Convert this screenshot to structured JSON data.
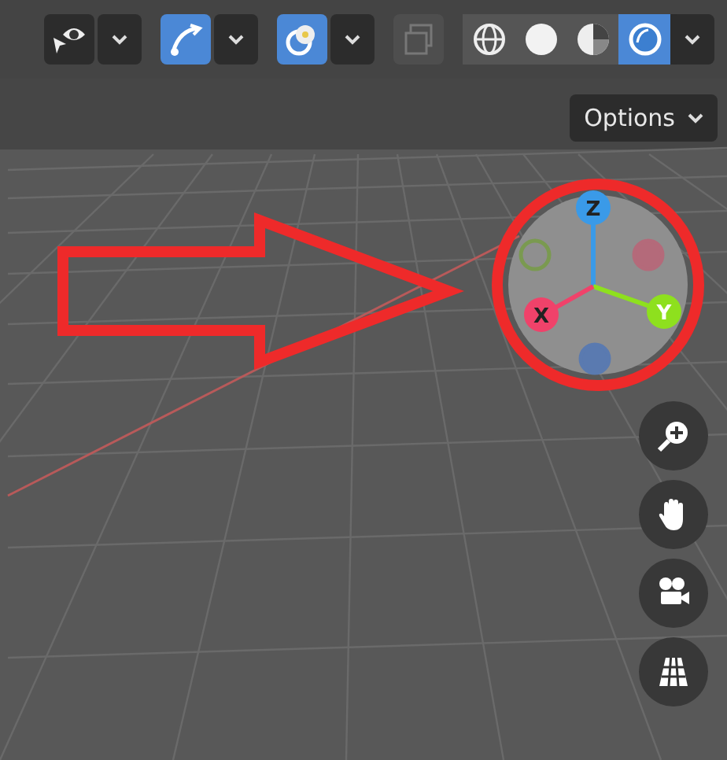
{
  "header": {
    "tools": [
      {
        "kind": "visibility",
        "selected": false,
        "disabled": false,
        "dropdown": true
      },
      {
        "kind": "gizmo",
        "selected": true,
        "disabled": false,
        "dropdown": true
      },
      {
        "kind": "overlays",
        "selected": true,
        "disabled": false,
        "dropdown": true
      },
      {
        "kind": "xray",
        "selected": false,
        "disabled": true,
        "dropdown": false
      }
    ],
    "shading": {
      "modes": [
        {
          "kind": "wireframe",
          "selected": false
        },
        {
          "kind": "solid",
          "selected": false
        },
        {
          "kind": "material",
          "selected": false
        },
        {
          "kind": "rendered",
          "selected": true
        }
      ],
      "dropdown": true
    }
  },
  "options_button": {
    "label": "Options"
  },
  "gizmo": {
    "axes": [
      {
        "kind": "z",
        "label": "Z",
        "color": "#3a9ae8"
      },
      {
        "kind": "y",
        "label": "Y",
        "color": "#8ee01e"
      },
      {
        "kind": "x",
        "label": "X",
        "color": "#f0426a"
      },
      {
        "kind": "negy",
        "color": "#7a9a50"
      },
      {
        "kind": "negx",
        "color": "#b46a7a"
      },
      {
        "kind": "negz",
        "color": "#5a7ab0"
      }
    ]
  },
  "nav_buttons": [
    {
      "kind": "zoom"
    },
    {
      "kind": "pan"
    },
    {
      "kind": "camera"
    },
    {
      "kind": "perspective"
    }
  ]
}
